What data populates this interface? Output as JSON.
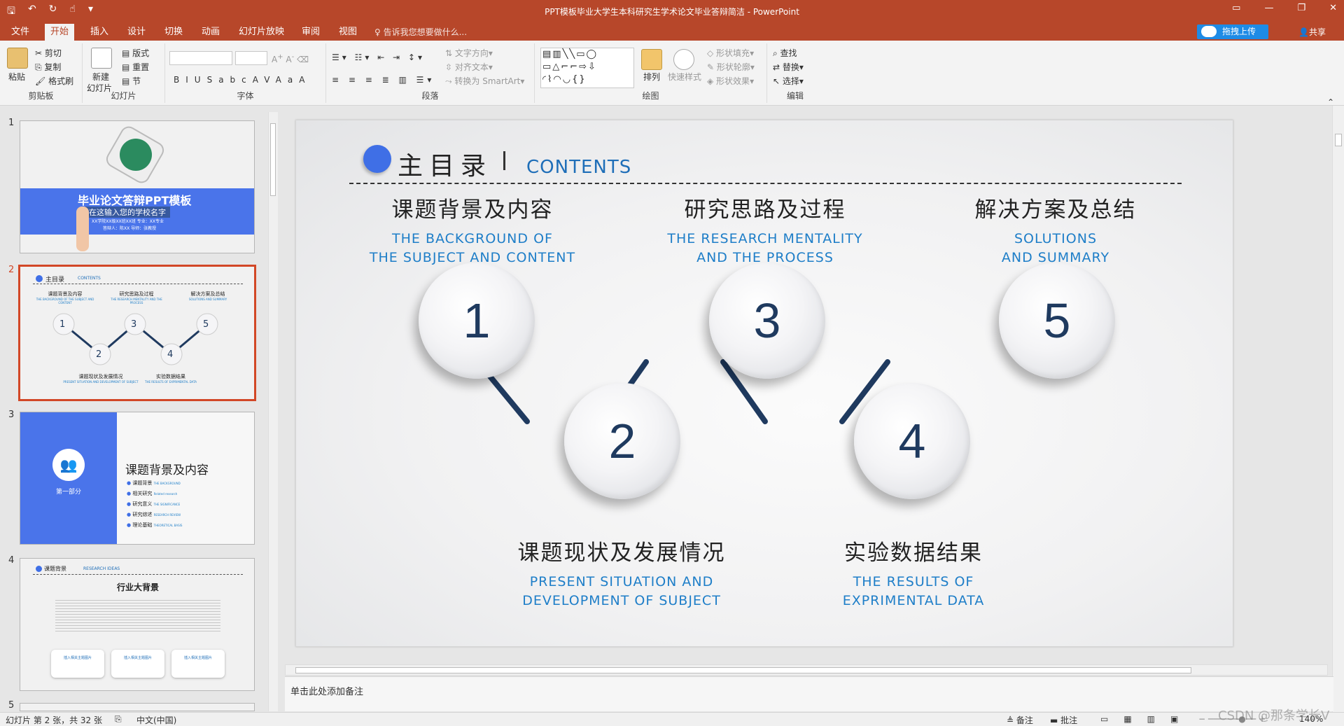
{
  "window": {
    "title": "PPT模板毕业大学生本科研究生学术论文毕业答辩简洁 - PowerPoint",
    "quick_access": [
      "save-icon",
      "undo-icon",
      "redo-icon",
      "touch-icon",
      "customize-icon"
    ],
    "controls": [
      "ribbon-display-icon",
      "minimize-icon",
      "restore-icon",
      "close-icon"
    ]
  },
  "tabs": [
    "文件",
    "开始",
    "插入",
    "设计",
    "切换",
    "动画",
    "幻灯片放映",
    "审阅",
    "视图"
  ],
  "active_tab": "开始",
  "tell_me": "告诉我您想要做什么...",
  "upload_label": "拖拽上传",
  "share_label": "共享",
  "ribbon": {
    "clipboard": {
      "label": "剪贴板",
      "paste": "粘贴",
      "cut": "剪切",
      "copy": "复制",
      "format_painter": "格式刷"
    },
    "slides": {
      "label": "幻灯片",
      "new_slide_1": "新建",
      "new_slide_2": "幻灯片",
      "layout": "版式",
      "reset": "重置",
      "section": "节"
    },
    "font": {
      "label": "字体",
      "buttons": [
        "B",
        "I",
        "U",
        "S",
        "abc",
        "AV",
        "Aa",
        "A"
      ]
    },
    "paragraph": {
      "label": "段落",
      "text_direction": "文字方向",
      "align_text": "对齐文本",
      "smartart": "转换为 SmartArt"
    },
    "drawing": {
      "label": "绘图",
      "arrange": "排列",
      "quick_styles": "快速样式",
      "shape_fill": "形状填充",
      "shape_outline": "形状轮廓",
      "shape_effects": "形状效果"
    },
    "editing": {
      "label": "编辑",
      "find": "查找",
      "replace": "替换",
      "select": "选择"
    }
  },
  "thumbnails": {
    "numbers": [
      "1",
      "2",
      "3",
      "4",
      "5"
    ],
    "t1": {
      "title": "毕业论文答辩PPT模板",
      "subtitle": "在这输入您的学校名字",
      "line1": "XX学院XX级XX班XX班      专业：XX专业",
      "line2": "答辩人：陈XX    导师：张教授"
    },
    "t2": {
      "title": "主目录",
      "en": "CONTENTS",
      "items": [
        {
          "zh": "课题背景及内容",
          "en": "THE BACKGROUND OF THE SUBJECT AND CONTENT"
        },
        {
          "zh": "研究思路及过程",
          "en": "THE RESEARCH MENTALITY AND THE PROCESS"
        },
        {
          "zh": "解决方案及总结",
          "en": "SOLUTIONS AND SUMMARY"
        },
        {
          "zh": "课题现状及发展情况",
          "en": "PRESENT SITUATION AND DEVELOPMENT OF SUBJECT"
        },
        {
          "zh": "实验数据结果",
          "en": "THE RESULTS OF EXPRIMENTAL DATA"
        }
      ]
    },
    "t3": {
      "part": "第一部分",
      "title": "课题背景及内容",
      "items": [
        {
          "zh": "课题背景",
          "en": "THE BACKGROUND"
        },
        {
          "zh": "相关研究",
          "en": "Related research"
        },
        {
          "zh": "研究意义",
          "en": "THE SIGNIFICANCE"
        },
        {
          "zh": "研究综述",
          "en": "RESEARCH REVIEW"
        },
        {
          "zh": "理论基础",
          "en": "THEORETICAL BASIS"
        }
      ]
    },
    "t4": {
      "title": "课题背景",
      "en": "RESEARCH IDEAS",
      "heading": "行业大背景",
      "cards": [
        "插入相关主题图片",
        "插入相关主题图片",
        "插入相关主题图片"
      ]
    }
  },
  "slide": {
    "title": "主目录",
    "title_en": "CONTENTS",
    "items": [
      {
        "num": "1",
        "zh": "课题背景及内容",
        "en1": "THE BACKGROUND OF",
        "en2": "THE SUBJECT AND CONTENT"
      },
      {
        "num": "2",
        "zh": "课题现状及发展情况",
        "en1": "PRESENT SITUATION AND",
        "en2": "DEVELOPMENT OF SUBJECT"
      },
      {
        "num": "3",
        "zh": "研究思路及过程",
        "en1": "THE RESEARCH MENTALITY",
        "en2": "AND THE PROCESS"
      },
      {
        "num": "4",
        "zh": "实验数据结果",
        "en1": "THE RESULTS OF",
        "en2": "EXPRIMENTAL DATA"
      },
      {
        "num": "5",
        "zh": "解决方案及总结",
        "en1": "SOLUTIONS",
        "en2": "AND SUMMARY"
      }
    ]
  },
  "notes_placeholder": "单击此处添加备注",
  "status": {
    "slide_info": "幻灯片 第 2 张，共 32 张",
    "language": "中文(中国)",
    "notes": "备注",
    "comments": "批注",
    "zoom": "140%",
    "watermark": "CSDN @那条学长V"
  },
  "colors": {
    "accent": "#b7472a",
    "blue": "#3f6fe6",
    "caption_blue": "#1e7ec8",
    "connector": "#1f3a5f"
  }
}
